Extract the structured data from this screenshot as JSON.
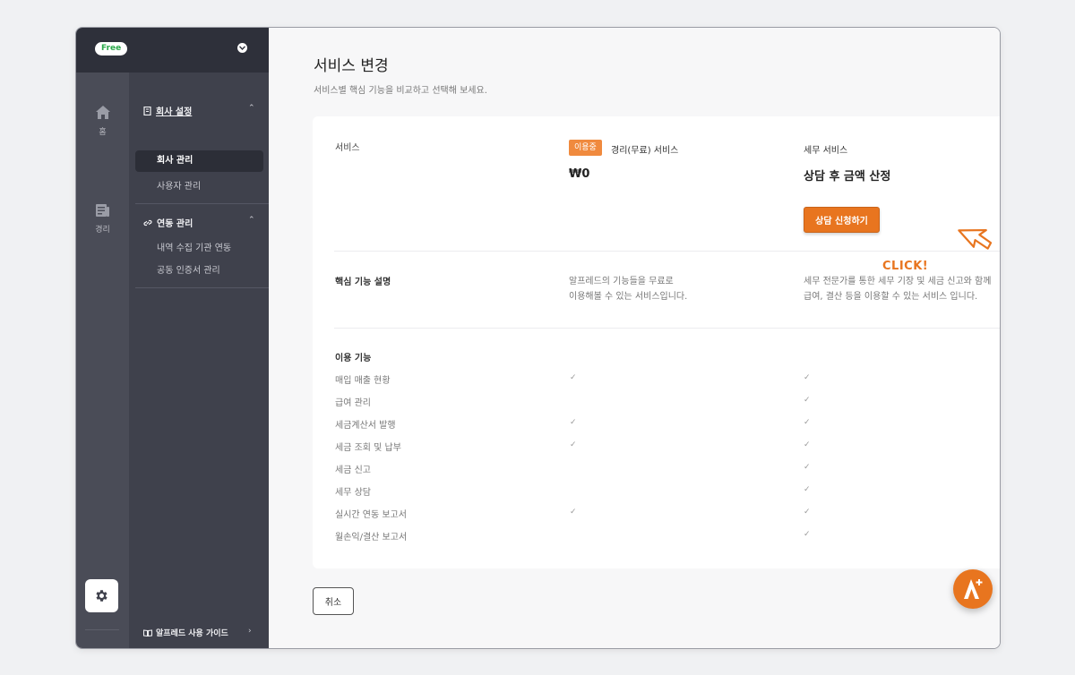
{
  "badge_free": "Free",
  "rail": {
    "home_label": "홈",
    "ledger_label": "경리"
  },
  "panel": {
    "company_group": "회사 설정",
    "company_items": [
      "회사 관리",
      "사용자 관리"
    ],
    "link_group": "연동 관리",
    "link_items": [
      "내역 수집 기관 연동",
      "공동 인증서 관리"
    ],
    "guide": "알프레드 사용 가이드"
  },
  "page": {
    "title": "서비스 변경",
    "subtitle": "서비스별 핵심 기능을 비교하고 선택해 보세요."
  },
  "compare": {
    "service_label": "서비스",
    "plan_free": {
      "badge": "이용중",
      "name": "경리(무료) 서비스",
      "price": "₩0",
      "desc_line1": "알프레드의 기능들을 무료로",
      "desc_line2": "이용해볼 수 있는 서비스입니다."
    },
    "plan_tax": {
      "name": "세무 서비스",
      "price": "상담 후 금액 산정",
      "button": "상담 신청하기",
      "desc_line1": "세무 전문가를 통한 세무 기장 및 세금 신고와 함께",
      "desc_line2": "급여, 결산 등을 이용할 수 있는 서비스 입니다."
    },
    "core_label": "핵심 기능 설명",
    "features_label": "이용 기능",
    "features": [
      {
        "name": "매입 매출 현황",
        "free": true,
        "tax": true
      },
      {
        "name": "급여 관리",
        "free": false,
        "tax": true
      },
      {
        "name": "세금계산서 발행",
        "free": true,
        "tax": true
      },
      {
        "name": "세금 조회 및 납부",
        "free": true,
        "tax": true
      },
      {
        "name": "세금 신고",
        "free": false,
        "tax": true
      },
      {
        "name": "세무 상담",
        "free": false,
        "tax": true
      },
      {
        "name": "실시간 연동 보고서",
        "free": true,
        "tax": true
      },
      {
        "name": "월손익/결산 보고서",
        "free": false,
        "tax": true
      }
    ],
    "check_glyph": "✓"
  },
  "annotation": {
    "click": "CLICK!"
  },
  "cancel": "취소",
  "colors": {
    "accent": "#e8751f",
    "sidebar_dark": "#2e303a",
    "rail": "#4a4c57",
    "panel": "#3f414c"
  }
}
